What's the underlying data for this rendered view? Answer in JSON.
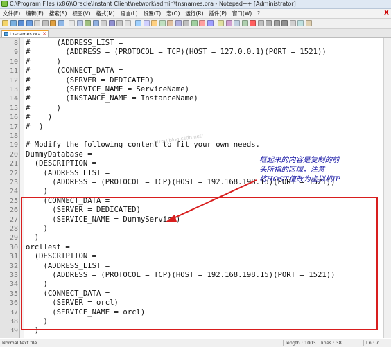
{
  "window": {
    "title": "C:\\Program Files (x86)\\Oracle\\Instant Client\\network\\admin\\tnsnames.ora - Notepad++ [Administrator]"
  },
  "menu": [
    "文件(F)",
    "编辑(E)",
    "搜索(S)",
    "视图(V)",
    "格式(M)",
    "语言(L)",
    "设置(T)",
    "宏(O)",
    "运行(R)",
    "插件(P)",
    "窗口(W)",
    "?"
  ],
  "menu_close": "X",
  "tab": {
    "label": "tnsnames.ora",
    "close": "✕"
  },
  "editor": {
    "lines": [
      {
        "n": "8",
        "text": "#      (ADDRESS_LIST ="
      },
      {
        "n": "9",
        "text": "#        (ADDRESS = (PROTOCOL = TCP)(HOST = 127.0.0.1)(PORT = 1521))"
      },
      {
        "n": "10",
        "text": "#      )"
      },
      {
        "n": "11",
        "text": "#      (CONNECT_DATA ="
      },
      {
        "n": "12",
        "text": "#        (SERVER = DEDICATED)"
      },
      {
        "n": "13",
        "text": "#        (SERVICE_NAME = ServiceName)"
      },
      {
        "n": "14",
        "text": "#        (INSTANCE_NAME = InstanceName)"
      },
      {
        "n": "15",
        "text": "#      )"
      },
      {
        "n": "16",
        "text": "#    )"
      },
      {
        "n": "17",
        "text": "#  )"
      },
      {
        "n": "18",
        "text": ""
      },
      {
        "n": "19",
        "text": "# Modify the following content to fit your own needs."
      },
      {
        "n": "20",
        "text": "DummyDatabase ="
      },
      {
        "n": "21",
        "text": "  (DESCRIPTION ="
      },
      {
        "n": "22",
        "text": "    (ADDRESS_LIST ="
      },
      {
        "n": "23",
        "text": "      (ADDRESS = (PROTOCOL = TCP)(HOST = 192.168.198.15)(PORT = 1521))"
      },
      {
        "n": "24",
        "text": "    )"
      },
      {
        "n": "25",
        "text": "    (CONNECT_DATA ="
      },
      {
        "n": "26",
        "text": "      (SERVER = DEDICATED)"
      },
      {
        "n": "27",
        "text": "      (SERVICE_NAME = DummyService)"
      },
      {
        "n": "28",
        "text": "    )"
      },
      {
        "n": "29",
        "text": "  )"
      },
      {
        "n": "30",
        "text": "orclTest ="
      },
      {
        "n": "31",
        "text": "  (DESCRIPTION ="
      },
      {
        "n": "32",
        "text": "    (ADDRESS_LIST ="
      },
      {
        "n": "33",
        "text": "      (ADDRESS = (PROTOCOL = TCP)(HOST = 192.168.198.15)(PORT = 1521))"
      },
      {
        "n": "34",
        "text": "    )"
      },
      {
        "n": "35",
        "text": "    (CONNECT_DATA ="
      },
      {
        "n": "36",
        "text": "      (SERVER = orcl)"
      },
      {
        "n": "37",
        "text": "      (SERVICE_NAME = orcl)"
      },
      {
        "n": "38",
        "text": "    )"
      },
      {
        "n": "39",
        "text": "  )"
      }
    ]
  },
  "annotation": {
    "lines": [
      "框起来的内容是复制的前",
      "头所指的区域，注意",
      "将HOST值改为虚拟机IP"
    ],
    "watermark": "http://blog.csdn.net/"
  },
  "status": {
    "file_type": "Normal text file",
    "length": "length : 1003",
    "lines": "lines : 38",
    "ln": "Ln : 7"
  },
  "colors": {
    "highlight": "#d81e1e",
    "annotation_text": "#1a1aa6",
    "arrow": "#d81e1e"
  }
}
